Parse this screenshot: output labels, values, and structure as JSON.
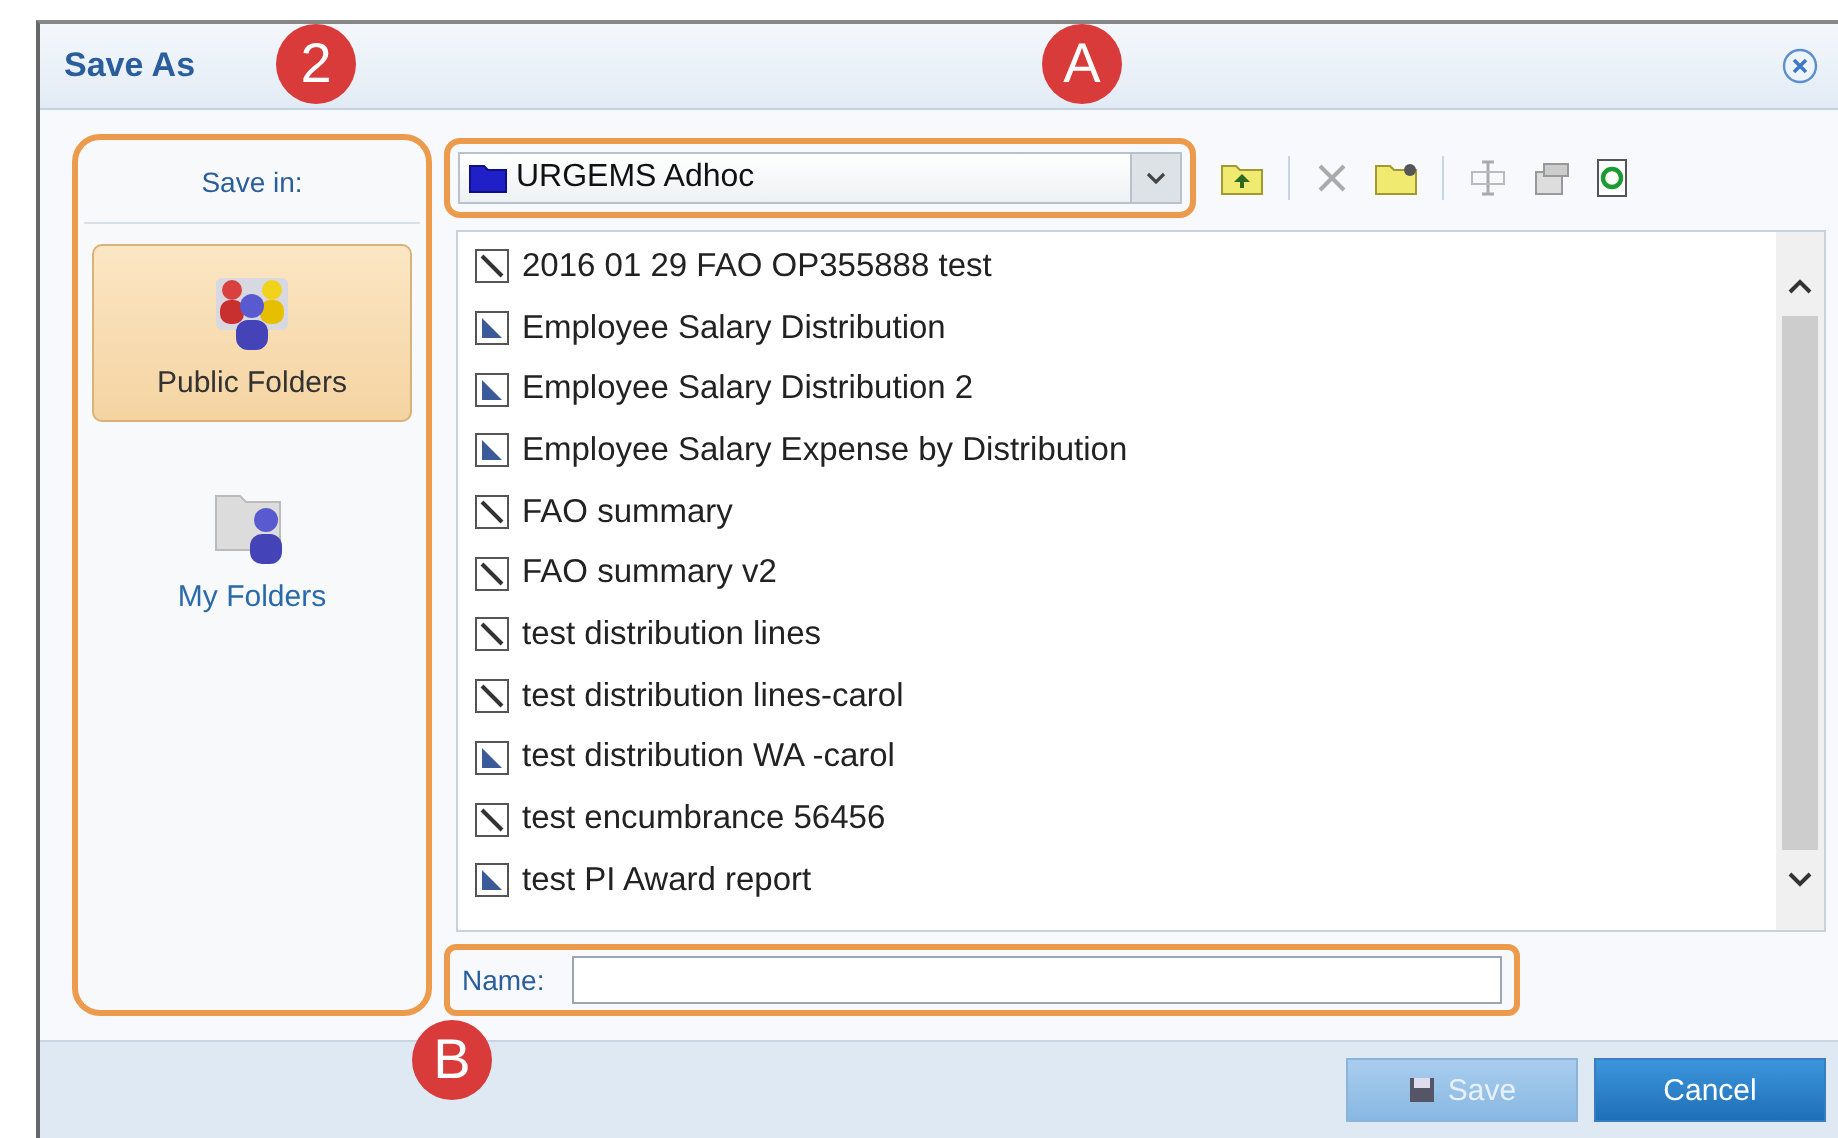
{
  "window": {
    "title": "Save As"
  },
  "badges": [
    {
      "label": "2"
    },
    {
      "label": "A"
    },
    {
      "label": "B"
    }
  ],
  "sidebar": {
    "label": "Save in:",
    "items": [
      {
        "label": "Public Folders",
        "kind": "public",
        "selected": true
      },
      {
        "label": "My Folders",
        "kind": "my",
        "selected": false
      }
    ]
  },
  "location": {
    "value": "URGEMS Adhoc"
  },
  "files": [
    {
      "name": "2016 01 29 FAO OP355888 test",
      "kind": "report"
    },
    {
      "name": "Employee Salary Distribution",
      "kind": "chart"
    },
    {
      "name": "Employee Salary Distribution 2",
      "kind": "chart"
    },
    {
      "name": "Employee Salary Expense by Distribution",
      "kind": "chart"
    },
    {
      "name": "FAO summary",
      "kind": "report"
    },
    {
      "name": "FAO summary v2",
      "kind": "report"
    },
    {
      "name": "test distribution lines",
      "kind": "report"
    },
    {
      "name": "test distribution lines-carol",
      "kind": "report"
    },
    {
      "name": "test distribution WA -carol",
      "kind": "chart"
    },
    {
      "name": "test encumbrance 56456",
      "kind": "report"
    },
    {
      "name": "test PI Award report",
      "kind": "chart"
    }
  ],
  "name_field": {
    "label": "Name:"
  },
  "buttons": [
    {
      "label": "Save",
      "kind": "save",
      "disabled": true
    },
    {
      "label": "Cancel",
      "kind": "cancel",
      "disabled": false
    }
  ]
}
